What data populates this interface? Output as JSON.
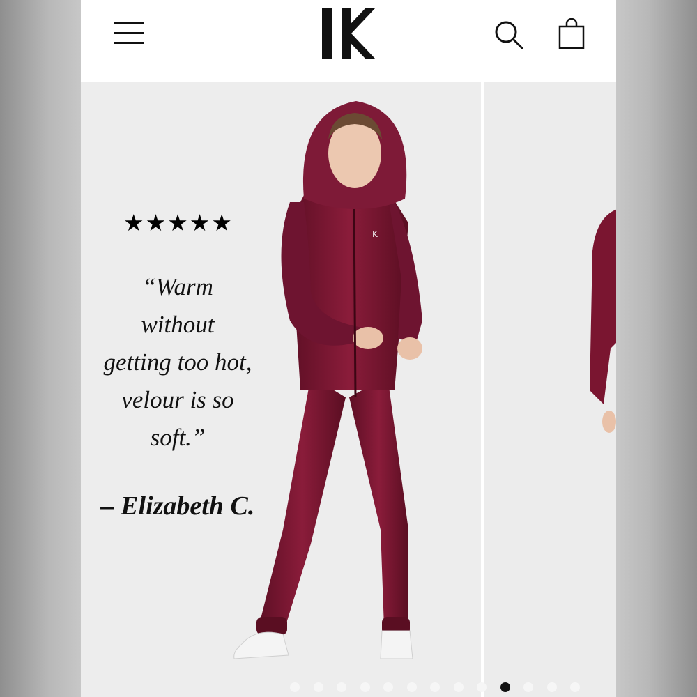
{
  "header": {
    "menu_icon": "hamburger-menu-icon",
    "logo_icon": "brand-logo-icon",
    "search_icon": "search-icon",
    "bag_icon": "shopping-bag-icon"
  },
  "review": {
    "stars": "★★★★★",
    "rating": 5,
    "quote_lines": [
      "“Warm",
      "without",
      "getting too hot,",
      "velour is so",
      "soft.”"
    ],
    "author": "– Elizabeth C."
  },
  "product": {
    "color": "#7a1530"
  },
  "carousel": {
    "dot_count": 13,
    "active_index": 9
  }
}
